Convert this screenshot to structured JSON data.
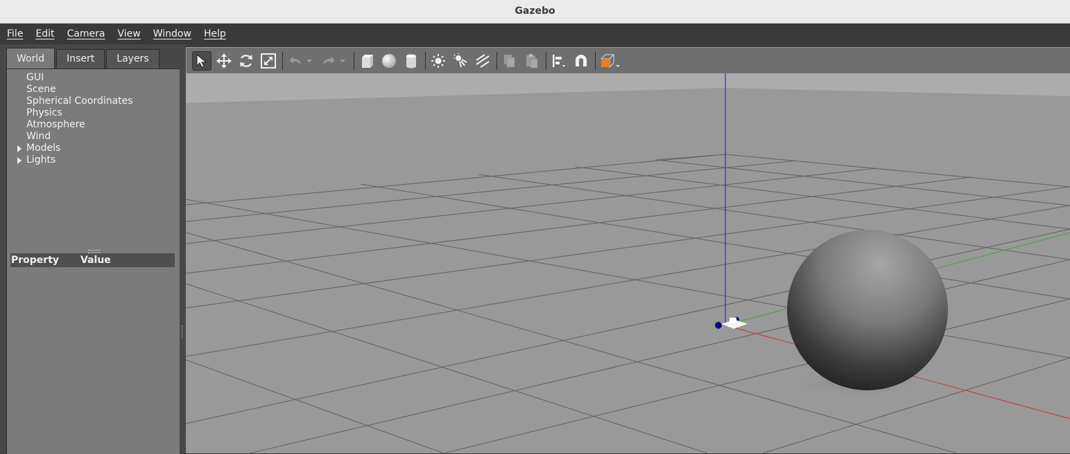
{
  "window": {
    "title": "Gazebo"
  },
  "menu": [
    "File",
    "Edit",
    "Camera",
    "View",
    "Window",
    "Help"
  ],
  "left_panel": {
    "tabs": [
      "World",
      "Insert",
      "Layers"
    ],
    "active_tab": "World",
    "tree": [
      {
        "label": "GUI",
        "expandable": false
      },
      {
        "label": "Scene",
        "expandable": false
      },
      {
        "label": "Spherical Coordinates",
        "expandable": false
      },
      {
        "label": "Physics",
        "expandable": false
      },
      {
        "label": "Atmosphere",
        "expandable": false
      },
      {
        "label": "Wind",
        "expandable": false
      },
      {
        "label": "Models",
        "expandable": true
      },
      {
        "label": "Lights",
        "expandable": true
      }
    ],
    "property_header": {
      "property": "Property",
      "value": "Value"
    }
  },
  "toolbar": {
    "tools": [
      {
        "name": "select-mode",
        "icon": "arrow-pointer-icon",
        "active": true
      },
      {
        "name": "translate-mode",
        "icon": "move-arrows-icon"
      },
      {
        "name": "rotate-mode",
        "icon": "rotate-icon"
      },
      {
        "name": "scale-mode",
        "icon": "scale-icon"
      },
      {
        "name": "undo",
        "icon": "undo-icon"
      },
      {
        "name": "redo",
        "icon": "redo-icon"
      },
      {
        "name": "box-shape",
        "icon": "box-icon"
      },
      {
        "name": "sphere-shape",
        "icon": "sphere-icon"
      },
      {
        "name": "cylinder-shape",
        "icon": "cylinder-icon"
      },
      {
        "name": "point-light",
        "icon": "point-light-icon"
      },
      {
        "name": "spot-light",
        "icon": "spot-light-icon"
      },
      {
        "name": "directional-light",
        "icon": "directional-light-icon"
      },
      {
        "name": "copy",
        "icon": "copy-icon"
      },
      {
        "name": "paste",
        "icon": "paste-icon"
      },
      {
        "name": "align",
        "icon": "align-icon"
      },
      {
        "name": "snap",
        "icon": "magnet-icon"
      },
      {
        "name": "view-angle",
        "icon": "view-cube-icon"
      }
    ],
    "accent_color": "#f07d1a"
  },
  "scene": {
    "background": "#9a9a9a",
    "axis_colors": {
      "x": "#c83232",
      "y": "#3aa63a",
      "z": "#2a2ad2"
    }
  }
}
